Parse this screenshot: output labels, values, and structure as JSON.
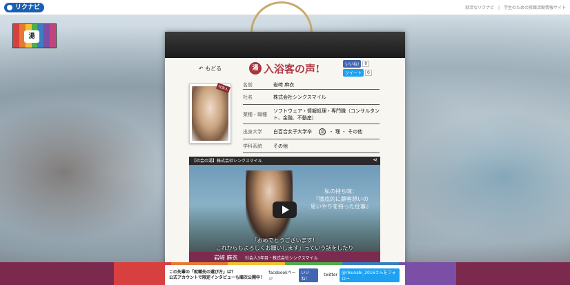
{
  "topbar": {
    "logo": "リクナビ",
    "nav_1": "就活なリクナビ",
    "nav_2": "学生のための就職活動情報サイト"
  },
  "flag": {
    "badge": "湯",
    "colors": [
      "#d8403f",
      "#e77a32",
      "#f2c230",
      "#4fae4a",
      "#3a7fc2",
      "#7a4fa5",
      "#c2447d"
    ]
  },
  "board": {
    "back_label": "もどる",
    "seal": "湯",
    "title": "入浴客の声!",
    "facebook_label": "いいね!",
    "facebook_count": "0",
    "twitter_label": "ツイート",
    "twitter_count": "0",
    "photo_tag": "社会人"
  },
  "profile": {
    "rows": [
      {
        "label": "名前",
        "value": "岩﨑 麻衣"
      },
      {
        "label": "社名",
        "value": "株式会社シンクスマイル"
      },
      {
        "label": "業種・職種",
        "value": "ソフトウェア・情報処理・専門職（コンサルタント、金融、不動産）"
      },
      {
        "label": "出身大学",
        "value": "白百合女子大学卒"
      },
      {
        "label": "学科系統",
        "value": "その他"
      }
    ],
    "major_circle": "文",
    "major_others": "・ 理 ・ その他"
  },
  "video": {
    "title": "【社会の湯】株式会社シンクスマイル",
    "caption_line1": "私の持ち味：",
    "caption_line2": "『徹底的に顧客想いの",
    "caption_line3": "思いやりを持った仕事』",
    "subtitle_line1": "「おめでとうございます！",
    "subtitle_line2": "これからもよろしくお願いします」っていう話をしたり",
    "name": "岩﨑 麻衣",
    "name_sub": "社会人3年目・株式会社シンクスマイル"
  },
  "banner": {
    "text_line1": "この先輩の「就職先の選び方」は？",
    "text_line2": "公式アカウントで限定インタビューも順次公開中！",
    "facebook_label": "facebookページ",
    "facebook_button": "いいね！",
    "twitter_label": "twitter",
    "twitter_button": "@rikunabi_2016さんをフォロー"
  }
}
